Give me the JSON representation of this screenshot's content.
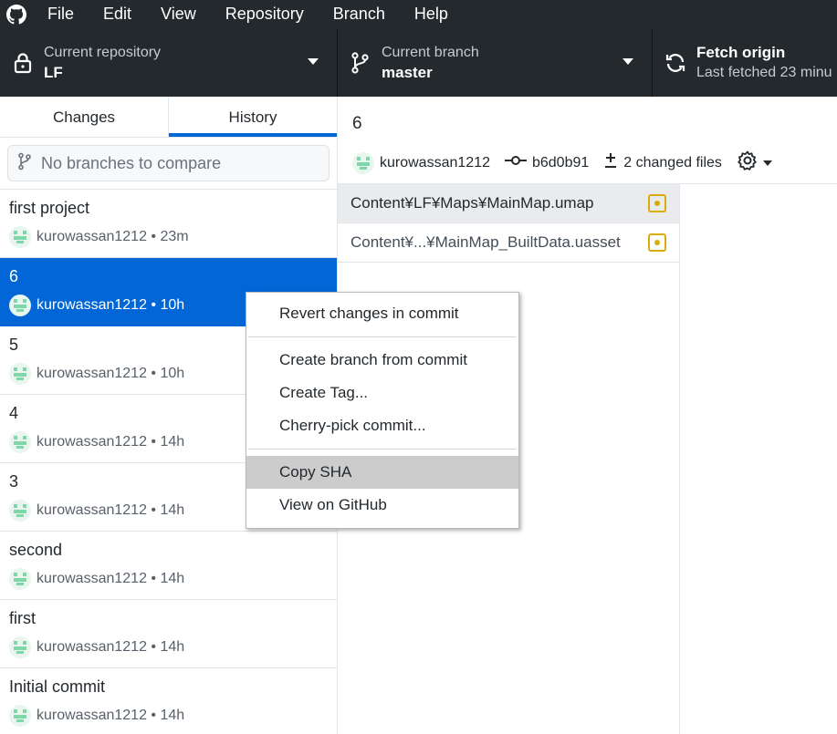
{
  "menu": {
    "items": [
      "File",
      "Edit",
      "View",
      "Repository",
      "Branch",
      "Help"
    ]
  },
  "toolbar": {
    "repository": {
      "label": "Current repository",
      "value": "LF"
    },
    "branch": {
      "label": "Current branch",
      "value": "master"
    },
    "fetch": {
      "label": "Fetch origin",
      "status": "Last fetched 23 minu"
    }
  },
  "sidebar": {
    "tabs": {
      "changes": "Changes",
      "history": "History"
    },
    "compare_placeholder": "No branches to compare",
    "commits": [
      {
        "title": "first project",
        "meta": "kurowassan1212 • 23m"
      },
      {
        "title": "6",
        "meta": "kurowassan1212 • 10h"
      },
      {
        "title": "5",
        "meta": "kurowassan1212 • 10h"
      },
      {
        "title": "4",
        "meta": "kurowassan1212 • 14h"
      },
      {
        "title": "3",
        "meta": "kurowassan1212 • 14h"
      },
      {
        "title": "second",
        "meta": "kurowassan1212 • 14h"
      },
      {
        "title": "first",
        "meta": "kurowassan1212 • 14h"
      },
      {
        "title": "Initial commit",
        "meta": "kurowassan1212 • 14h"
      }
    ]
  },
  "commit_detail": {
    "title": "6",
    "author": "kurowassan1212",
    "sha": "b6d0b91",
    "changed_files": "2 changed files",
    "files": [
      {
        "name": "Content¥LF¥Maps¥MainMap.umap",
        "status": "modified"
      },
      {
        "name": "Content¥...¥MainMap_BuiltData.uasset",
        "status": "modified"
      }
    ]
  },
  "context_menu": {
    "revert": "Revert changes in commit",
    "create_branch": "Create branch from commit",
    "create_tag": "Create Tag...",
    "cherry_pick": "Cherry-pick commit...",
    "copy_sha": "Copy SHA",
    "view_github": "View on GitHub"
  },
  "colors": {
    "toolbar_bg": "#24292e",
    "accent": "#0366d6",
    "modified": "#dbab09"
  }
}
